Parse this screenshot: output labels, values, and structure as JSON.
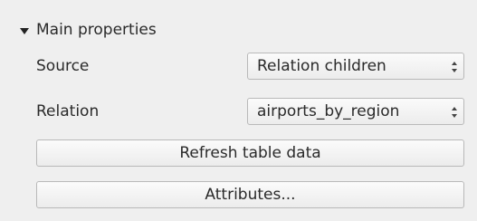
{
  "group": {
    "title": "Main properties",
    "expanded": true
  },
  "fields": [
    {
      "label": "Source",
      "value": "Relation children"
    },
    {
      "label": "Relation",
      "value": "airports_by_region"
    }
  ],
  "buttons": {
    "refresh": "Refresh table data",
    "attributes": "Attributes..."
  },
  "colors": {
    "background": "#efefef",
    "control_border": "#b9b9b9"
  }
}
